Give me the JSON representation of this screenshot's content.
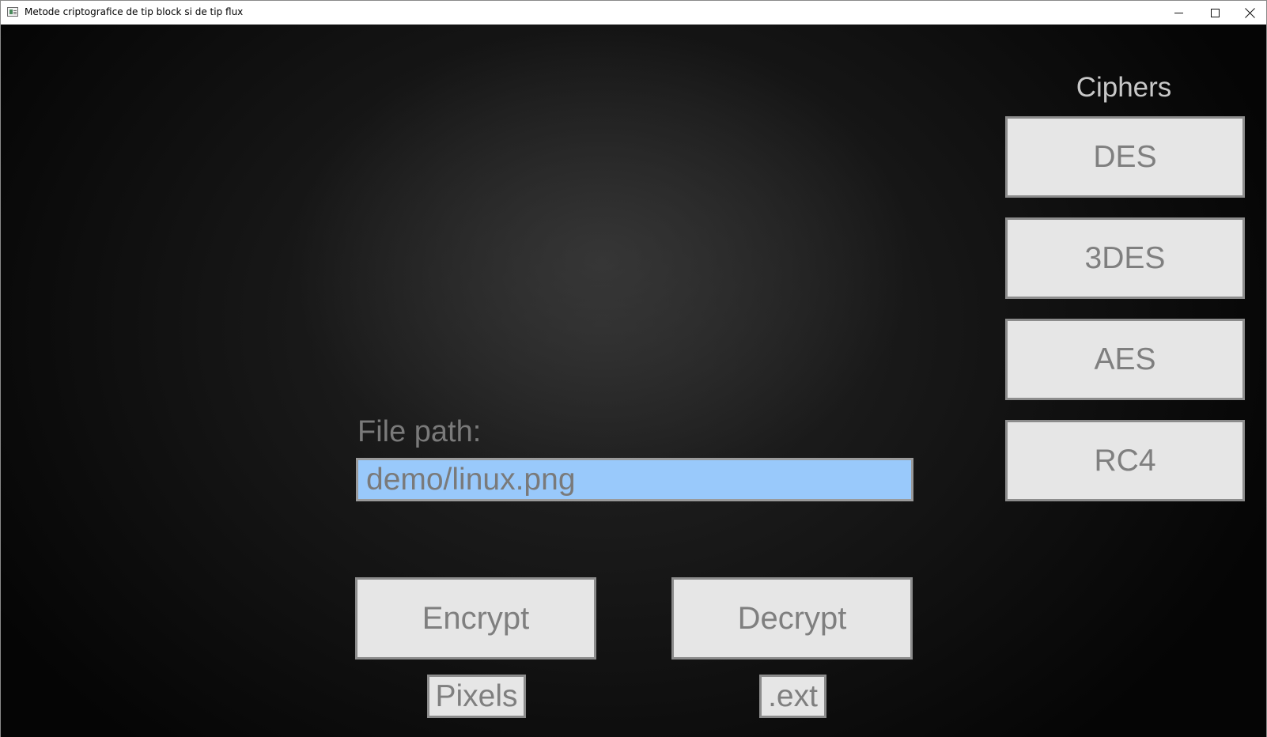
{
  "window": {
    "title": "Metode criptografice de tip block si de tip flux",
    "icon": "app-window-icon",
    "controls": [
      "minimize-icon",
      "maximize-icon",
      "close-icon"
    ]
  },
  "ciphers": {
    "heading": "Ciphers",
    "items": [
      {
        "label": "DES"
      },
      {
        "label": "3DES"
      },
      {
        "label": "AES"
      },
      {
        "label": "RC4"
      }
    ]
  },
  "file": {
    "label": "File path:",
    "value": "demo/linux.png"
  },
  "actions": {
    "encrypt_label": "Encrypt",
    "decrypt_label": "Decrypt",
    "pixels_label": "Pixels",
    "ext_label": ".ext"
  },
  "colors": {
    "background": "#141414",
    "button_face": "#e6e6e6",
    "button_text": "#7f7f7f",
    "input_background": "#99c9fb",
    "heading_text": "#c8c8c8"
  }
}
